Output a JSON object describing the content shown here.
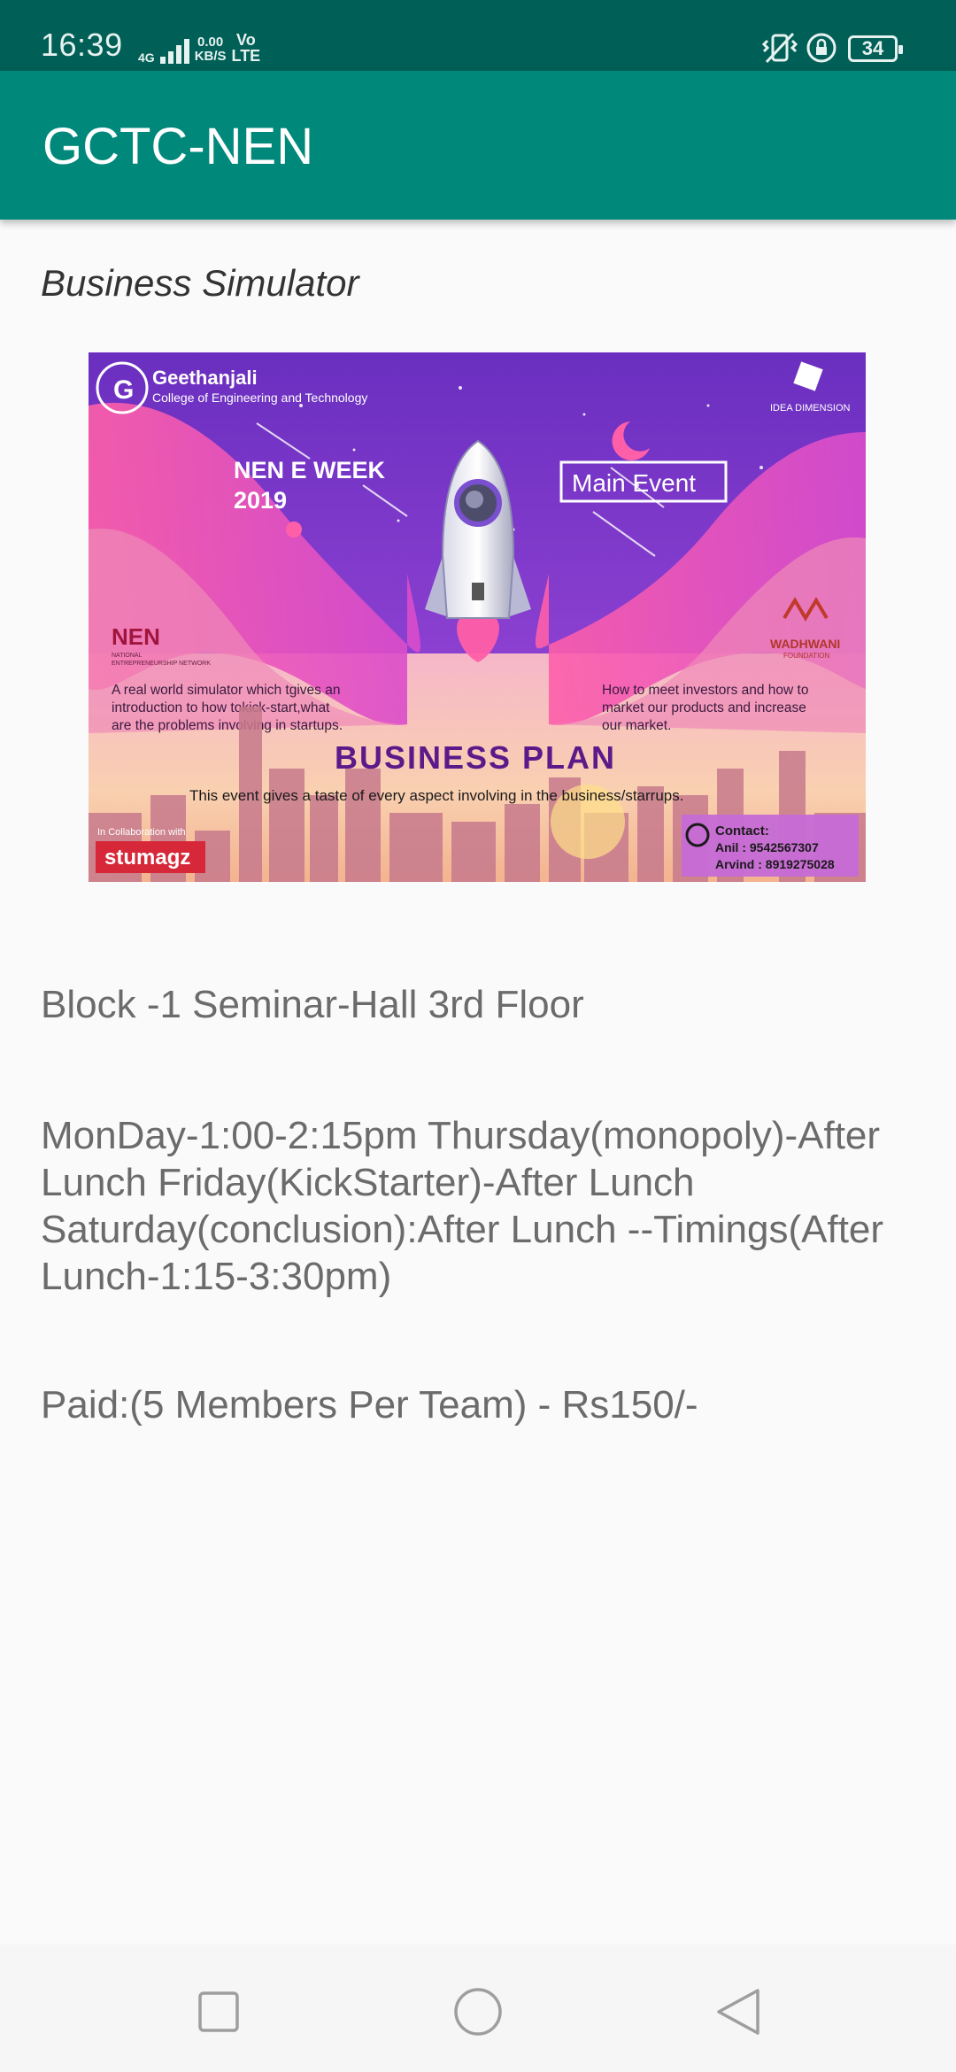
{
  "status_bar": {
    "time": "16:39",
    "network_type": "4G",
    "data_speed_value": "0.00",
    "data_speed_unit": "KB/S",
    "volte_top": "Vo",
    "volte_bottom": "LTE",
    "battery_level": "34"
  },
  "app_bar": {
    "title": "GCTC-NEN"
  },
  "event": {
    "title": "Business Simulator",
    "venue": "Block -1 Seminar-Hall 3rd Floor",
    "timings": "MonDay-1:00-2:15pm Thursday(monopoly)-After Lunch Friday(KickStarter)-After Lunch Saturday(conclusion):After Lunch --Timings(After Lunch-1:15-3:30pm)",
    "fee": "Paid:(5 Members Per Team) - Rs150/-"
  },
  "poster": {
    "college_name": "Geethanjali",
    "college_subtitle": "College of Engineering and Technology",
    "partner_logo_text": "IDEA DIMENSION",
    "week_line1": "NEN E WEEK",
    "week_line2": "2019",
    "badge": "Main Event",
    "nen_logo": "NEN",
    "nen_logo_sub1": "NATIONAL",
    "nen_logo_sub2": "ENTREPRENEURSHIP NETWORK",
    "wadhwani_logo": "WADHWANI",
    "wadhwani_sub": "FOUNDATION",
    "left_desc": [
      "A real world simulator which tgives an",
      "introduction to how tokick-start,what",
      "are the problems involving in startups."
    ],
    "right_desc": [
      "How to meet investors and how to",
      "market our products and increase",
      "our market."
    ],
    "headline": "BUSINESS PLAN",
    "tagline": "This event gives a taste of every aspect involving in the business/starrups.",
    "collab_label": "In Collaboration with",
    "collab_brand": "stumagz",
    "contact_label": "Contact:",
    "contact_1": "Anil     : 9542567307",
    "contact_2": "Arvind : 8919275028"
  },
  "colors": {
    "status_bar": "#005f56",
    "app_bar": "#00897b",
    "background": "#fafafa",
    "body_text": "#6b6b6b"
  }
}
